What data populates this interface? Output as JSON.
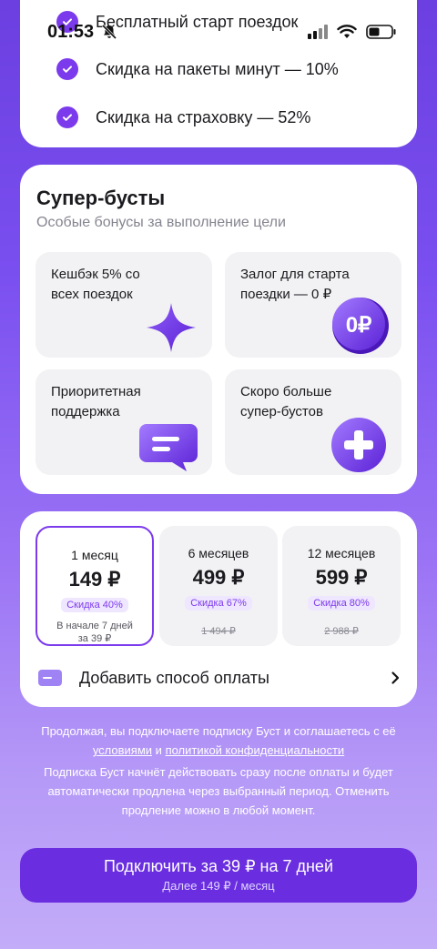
{
  "status_bar": {
    "time": "01:53"
  },
  "benefits": {
    "items": [
      "Бесплатный старт поездок",
      "Скидка на пакеты минут — 10%",
      "Скидка на страховку — 52%"
    ]
  },
  "super_boosts": {
    "title": "Супер-бусты",
    "subtitle": "Особые бонусы за выполнение цели",
    "tiles": [
      {
        "text": "Кешбэк 5% со\nвсех поездок",
        "icon": "star-sparkle-icon"
      },
      {
        "text": "Залог для старта\nпоездки — 0 ₽",
        "icon": "zero-ruble-coin-icon",
        "coin_label": "0₽"
      },
      {
        "text": "Приоритетная\nподдержка",
        "icon": "chat-bubble-icon"
      },
      {
        "text": "Скоро больше\nсупер-бустов",
        "icon": "plus-circle-icon"
      }
    ]
  },
  "plans": {
    "items": [
      {
        "term": "1 месяц",
        "price": "149 ₽",
        "discount": "Скидка 40%",
        "note": "В начале 7 дней\nза 39 ₽",
        "selected": true
      },
      {
        "term": "6 месяцев",
        "price": "499 ₽",
        "discount": "Скидка 67%",
        "old_price": "1 494 ₽",
        "selected": false
      },
      {
        "term": "12 месяцев",
        "price": "599 ₽",
        "discount": "Скидка 80%",
        "old_price": "2 988 ₽",
        "selected": false
      }
    ],
    "payment_label": "Добавить способ оплаты"
  },
  "legal": {
    "line1_prefix": "Продолжая, вы подключаете подписку Буст и соглашаетесь с её",
    "terms_link": "условиями",
    "and": "и",
    "privacy_link": "политикой конфиденциальности",
    "renewal": "Подписка Буст начнёт действовать сразу после оплаты и будет автоматически продлена через выбранный период. Отменить продление можно в любой момент."
  },
  "cta": {
    "label": "Подключить за 39 ₽ на 7 дней",
    "sublabel": "Далее 149 ₽ / месяц"
  },
  "colors": {
    "accent": "#7c3aed",
    "cta": "#6a2ee0"
  }
}
